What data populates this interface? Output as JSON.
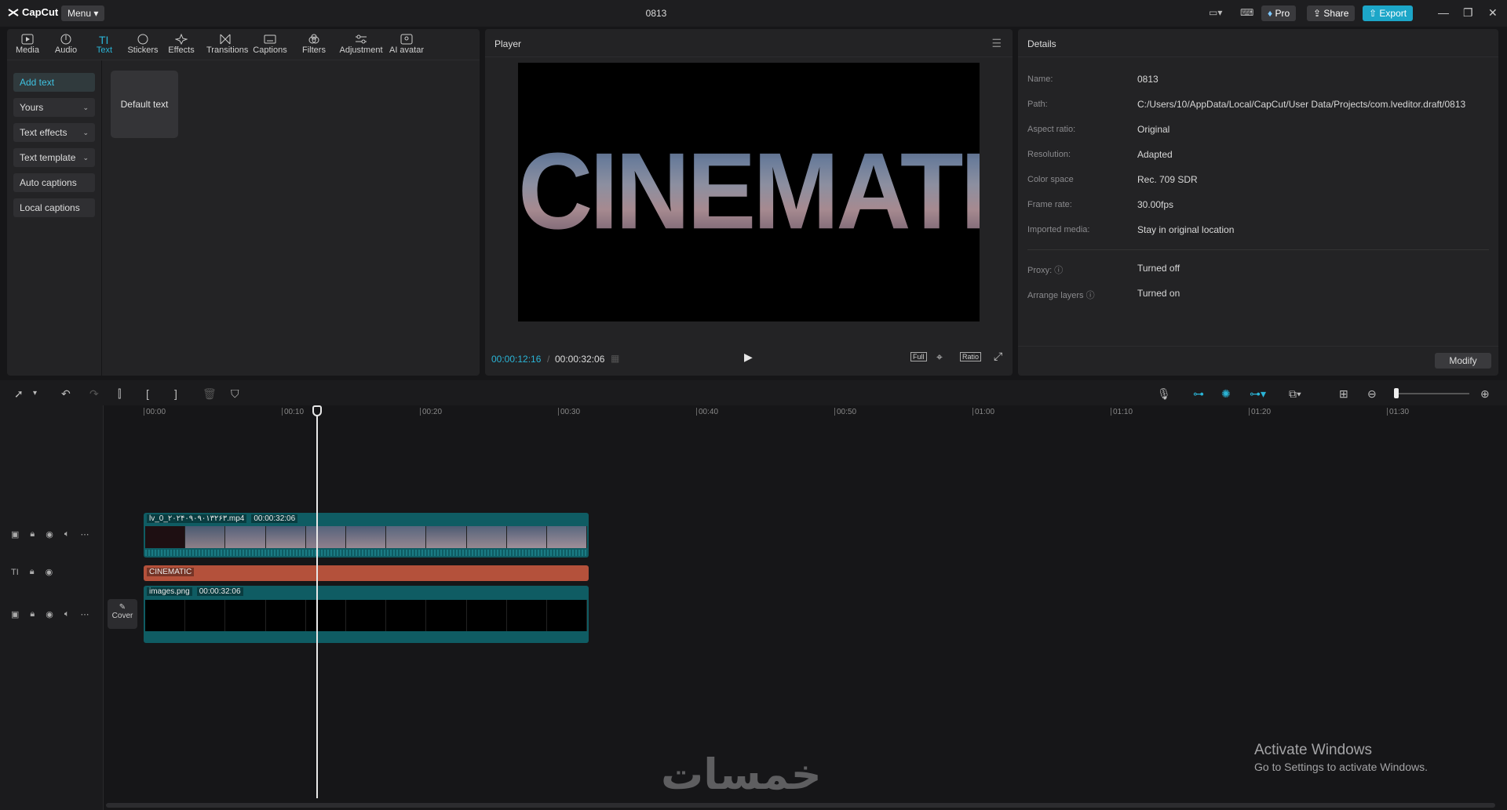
{
  "app": {
    "logo": "CapCut",
    "menu_label": "Menu",
    "project_title": "0813"
  },
  "topbar": {
    "pro_label": "Pro",
    "share_label": "Share",
    "export_label": "Export"
  },
  "toolbar": {
    "categories": [
      {
        "label": "Media",
        "icon": "media-icon"
      },
      {
        "label": "Audio",
        "icon": "audio-icon"
      },
      {
        "label": "Text",
        "icon": "text-icon"
      },
      {
        "label": "Stickers",
        "icon": "stickers-icon"
      },
      {
        "label": "Effects",
        "icon": "effects-icon"
      },
      {
        "label": "Transitions",
        "icon": "transitions-icon"
      },
      {
        "label": "Captions",
        "icon": "captions-icon"
      },
      {
        "label": "Filters",
        "icon": "filters-icon"
      },
      {
        "label": "Adjustment",
        "icon": "adjustment-icon"
      },
      {
        "label": "AI avatar",
        "icon": "ai-avatar-icon"
      }
    ],
    "active": "Text"
  },
  "sidebar": {
    "items": [
      {
        "label": "Add text"
      },
      {
        "label": "Yours"
      },
      {
        "label": "Text effects"
      },
      {
        "label": "Text template"
      },
      {
        "label": "Auto captions"
      },
      {
        "label": "Local captions"
      }
    ]
  },
  "content": {
    "default_text_card": "Default text"
  },
  "player": {
    "title": "Player",
    "overlay_text": "CINEMATIC",
    "current_time": "00:00:12:16",
    "total_time": "00:00:32:06",
    "full_label": "Full",
    "ratio_label": "Ratio"
  },
  "details": {
    "title": "Details",
    "rows": [
      {
        "label": "Name:",
        "value": "0813"
      },
      {
        "label": "Path:",
        "value": "C:/Users/10/AppData/Local/CapCut/User Data/Projects/com.lveditor.draft/0813"
      },
      {
        "label": "Aspect ratio:",
        "value": "Original"
      },
      {
        "label": "Resolution:",
        "value": "Adapted"
      },
      {
        "label": "Color space",
        "value": "Rec. 709 SDR"
      },
      {
        "label": "Frame rate:",
        "value": "30.00fps"
      },
      {
        "label": "Imported media:",
        "value": "Stay in original location"
      }
    ],
    "rows2": [
      {
        "label": "Proxy:",
        "value": "Turned off"
      },
      {
        "label": "Arrange layers",
        "value": "Turned on"
      }
    ],
    "modify_label": "Modify"
  },
  "timeline": {
    "ticks": [
      "00:00",
      "00:10",
      "00:20",
      "00:30",
      "00:40",
      "00:50",
      "01:00",
      "01:10",
      "01:20",
      "01:30"
    ],
    "video_clip": {
      "name": "lv_0_۲۰۲۴۰۹۰۹۰۱۳۲۶۳.mp4",
      "duration": "00:00:32:06"
    },
    "text_clip": {
      "name": "CINEMATIC"
    },
    "image_clip": {
      "name": "images.png",
      "duration": "00:00:32:06"
    },
    "cover_label": "Cover"
  },
  "watermark": {
    "line1": "Activate Windows",
    "line2": "Go to Settings to activate Windows."
  },
  "overlay_brand": "خمسات",
  "colors": {
    "accent": "#2ab4d6",
    "video_clip": "#0f5c63",
    "text_clip": "#b4513b",
    "export": "#1ca6c8"
  }
}
